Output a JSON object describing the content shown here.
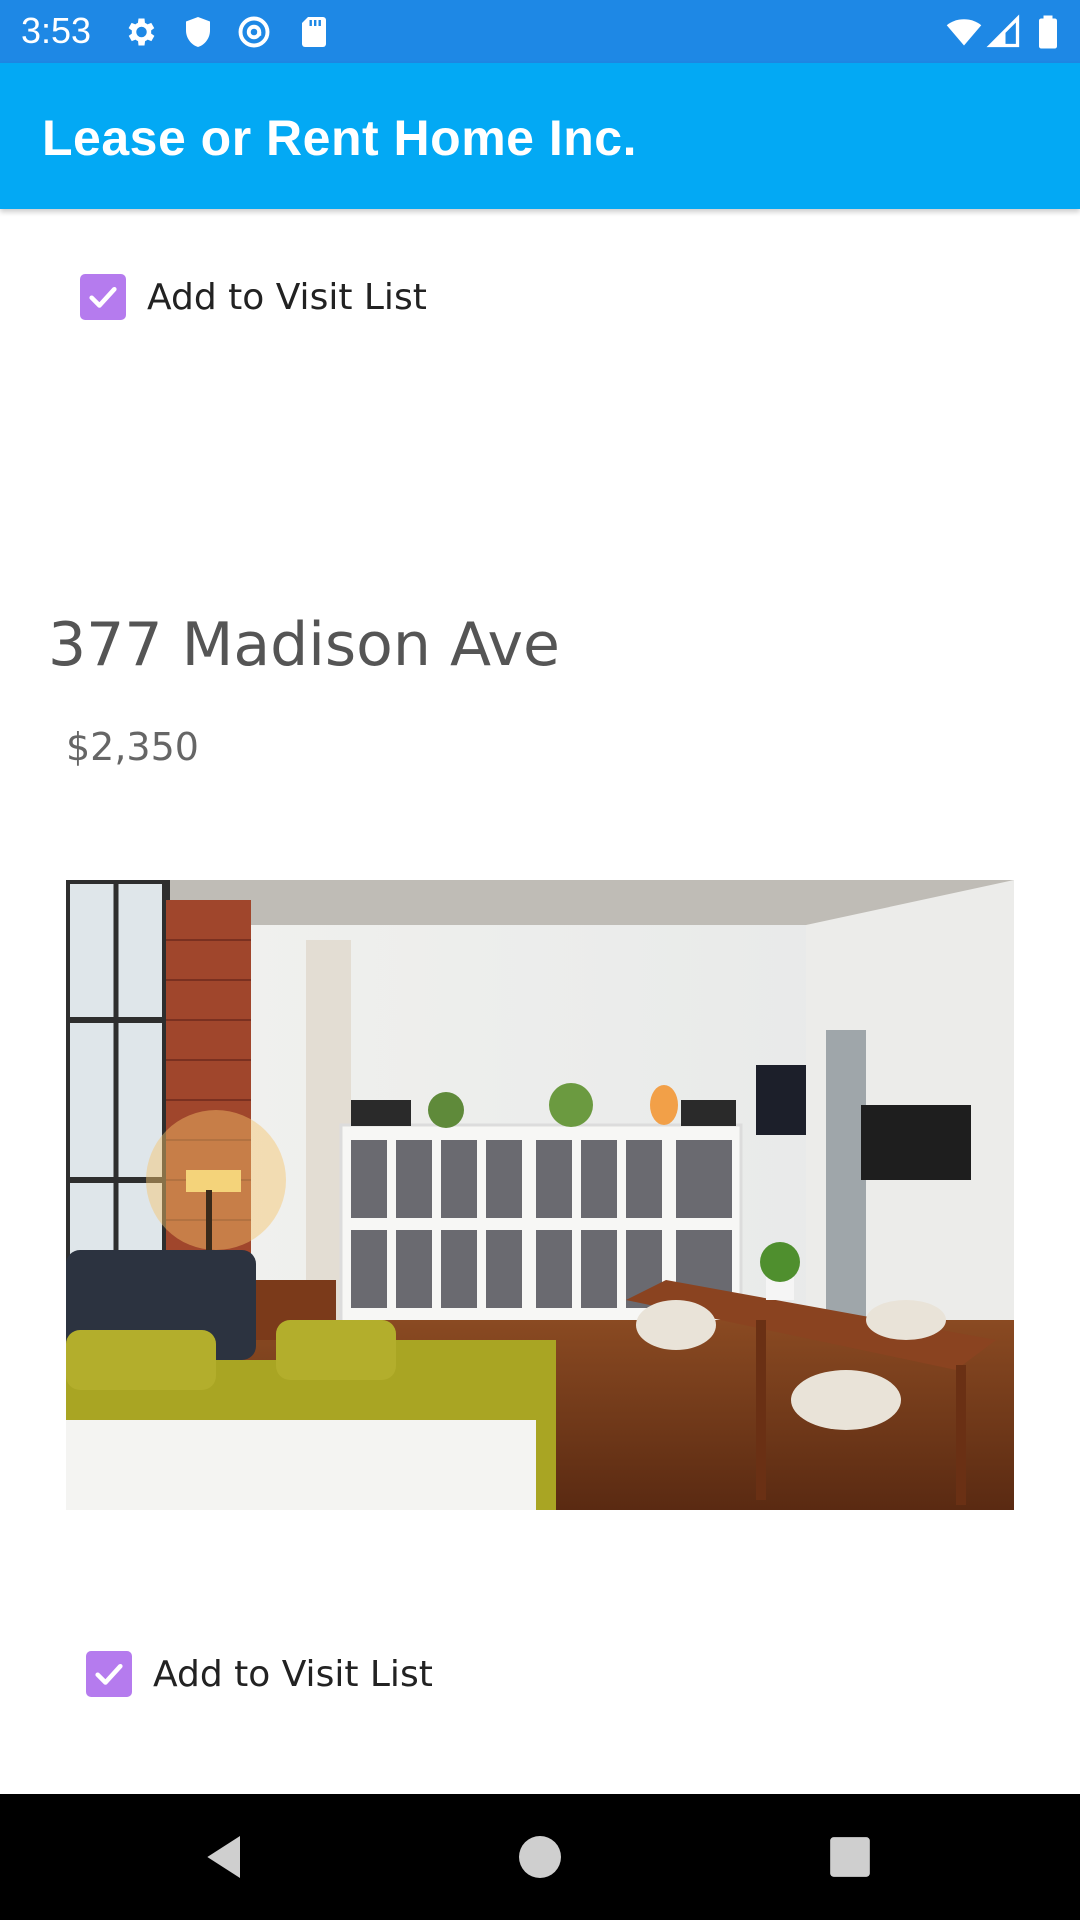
{
  "status_bar": {
    "time": "3:53",
    "left_icons": [
      "gear-icon",
      "shield-icon",
      "at-sign-icon",
      "sd-card-icon"
    ],
    "right_icons": [
      "wifi-icon",
      "signal-icon",
      "battery-icon"
    ],
    "color": "#1e88e5"
  },
  "app_bar": {
    "title": "Lease or Rent Home Inc.",
    "color": "#03a9f4"
  },
  "listings": [
    {
      "checkbox_label": "Add to Visit List",
      "checked": true
    },
    {
      "address": "377 Madison Ave",
      "price": "$2,350",
      "photo": "loft-living-room-photo",
      "checkbox_label": "Add to Visit List",
      "checked": true
    }
  ],
  "accent_color": "#b57bee",
  "nav_bar": {
    "buttons": [
      "back-icon",
      "home-icon",
      "recents-icon"
    ]
  }
}
